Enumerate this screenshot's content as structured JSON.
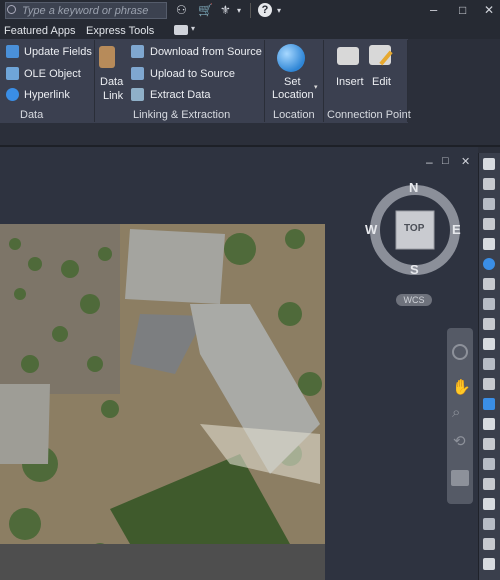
{
  "search": {
    "placeholder": "Type a keyword or phrase"
  },
  "top_icons": [
    "binoculars-icon",
    "cart-icon",
    "network-icon",
    "help-icon"
  ],
  "window_controls": {
    "min": "–",
    "restore": "□",
    "close": "✕"
  },
  "menu": {
    "featured": "Featured Apps",
    "express": "Express Tools"
  },
  "ribbon": {
    "data_panel": {
      "label": "Data",
      "items": [
        "Update Fields",
        "OLE Object",
        "Hyperlink"
      ]
    },
    "linking_panel": {
      "label": "Linking & Extraction",
      "data_link": [
        "Data",
        "Link"
      ],
      "items": [
        "Download from Source",
        "Upload to Source",
        "Extract  Data"
      ]
    },
    "location_panel": {
      "label": "Location",
      "set_location": [
        "Set",
        "Location"
      ]
    },
    "connection_panel": {
      "label": "Connection Point",
      "insert": "Insert",
      "edit": "Edit"
    }
  },
  "viewcube": {
    "n": "N",
    "s": "S",
    "e": "E",
    "w": "W",
    "top": "TOP",
    "ucs": "WCS"
  },
  "colors": {
    "ribbon": "#3b4050",
    "background": "#2b2f3a",
    "accent": "#3a8ee6"
  }
}
